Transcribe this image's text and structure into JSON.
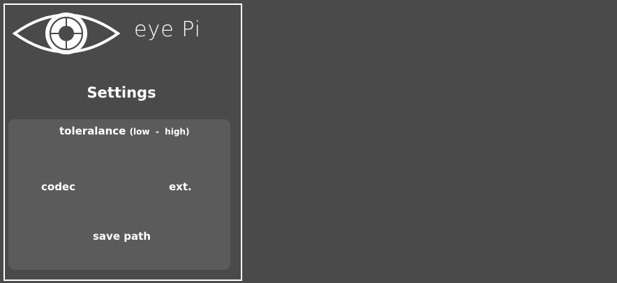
{
  "app": {
    "title": "eye Pi",
    "logo_icon": "eye-logo-icon"
  },
  "settings": {
    "heading": "Settings",
    "tolerance_label": "toleralance",
    "tolerance_range": "(low  -  high)",
    "codec_label": "codec",
    "ext_label": "ext.",
    "save_path_label": "save path"
  },
  "colors": {
    "background": "#4a4a4a",
    "card": "#5b5b5b",
    "foreground": "#ffffff"
  }
}
